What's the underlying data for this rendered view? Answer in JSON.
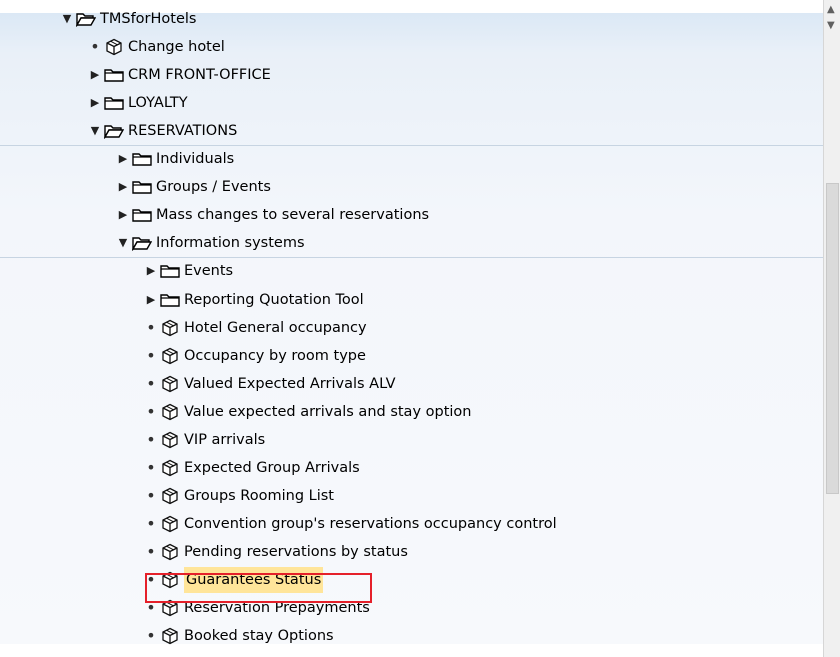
{
  "tree": [
    {
      "label": "TMSforHotels",
      "type": "folder",
      "expanded": true
    },
    {
      "label": "Change hotel",
      "type": "transaction"
    },
    {
      "label": "CRM FRONT-OFFICE",
      "type": "folder",
      "expanded": false
    },
    {
      "label": "LOYALTY",
      "type": "folder",
      "expanded": false
    },
    {
      "label": "RESERVATIONS",
      "type": "folder",
      "expanded": true
    },
    {
      "label": "Individuals",
      "type": "folder",
      "expanded": false
    },
    {
      "label": "Groups / Events",
      "type": "folder",
      "expanded": false
    },
    {
      "label": "Mass changes to several reservations",
      "type": "folder",
      "expanded": false
    },
    {
      "label": "Information systems",
      "type": "folder",
      "expanded": true
    },
    {
      "label": "Events",
      "type": "folder",
      "expanded": false
    },
    {
      "label": "Reporting Quotation Tool",
      "type": "folder",
      "expanded": false
    },
    {
      "label": "Hotel General occupancy",
      "type": "transaction"
    },
    {
      "label": "Occupancy by room type",
      "type": "transaction"
    },
    {
      "label": "Valued Expected Arrivals ALV",
      "type": "transaction"
    },
    {
      "label": "Value expected arrivals and stay option",
      "type": "transaction"
    },
    {
      "label": "VIP arrivals",
      "type": "transaction"
    },
    {
      "label": "Expected Group Arrivals",
      "type": "transaction"
    },
    {
      "label": "Groups Rooming List",
      "type": "transaction"
    },
    {
      "label": "Convention group's reservations occupancy control",
      "type": "transaction"
    },
    {
      "label": "Pending reservations by status",
      "type": "transaction"
    },
    {
      "label": "Guarantees Status",
      "type": "transaction",
      "selected": true
    },
    {
      "label": "Reservation Prepayments",
      "type": "transaction"
    },
    {
      "label": "Booked stay Options",
      "type": "transaction"
    }
  ],
  "icons": {
    "expanded": "caret-down-icon",
    "collapsed": "caret-right-icon",
    "folder": "folder-icon",
    "folder_open": "folder-open-icon",
    "transaction": "cube-icon"
  },
  "colors": {
    "highlight_border": "#e5202a",
    "selected_bg": "#ffe59a"
  }
}
